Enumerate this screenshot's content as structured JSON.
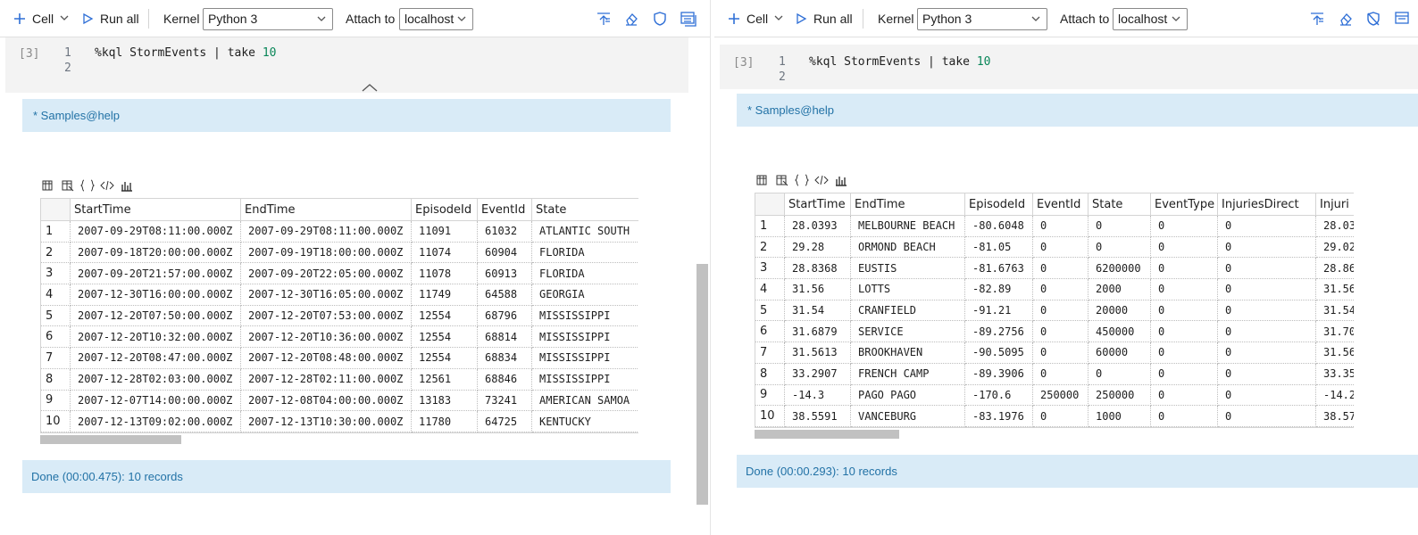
{
  "toolbar": {
    "add_cell_label": "Cell",
    "run_all_label": "Run all",
    "kernel_label": "Kernel",
    "kernel_value": "Python 3",
    "attach_label": "Attach to",
    "attach_value": "localhost"
  },
  "left": {
    "cell_number": "[3]",
    "line_numbers": [
      "1",
      "2"
    ],
    "code_text": "%kql StormEvents | take ",
    "code_number": "10",
    "info_banner": "* Samples@help",
    "done_banner": "Done (00:00.475): 10 records",
    "table": {
      "columns": [
        "",
        "StartTime",
        "EndTime",
        "EpisodeId",
        "EventId",
        "State"
      ],
      "rows": [
        [
          "1",
          "2007-09-29T08:11:00.000Z",
          "2007-09-29T08:11:00.000Z",
          "11091",
          "61032",
          "ATLANTIC SOUTH"
        ],
        [
          "2",
          "2007-09-18T20:00:00.000Z",
          "2007-09-19T18:00:00.000Z",
          "11074",
          "60904",
          "FLORIDA"
        ],
        [
          "3",
          "2007-09-20T21:57:00.000Z",
          "2007-09-20T22:05:00.000Z",
          "11078",
          "60913",
          "FLORIDA"
        ],
        [
          "4",
          "2007-12-30T16:00:00.000Z",
          "2007-12-30T16:05:00.000Z",
          "11749",
          "64588",
          "GEORGIA"
        ],
        [
          "5",
          "2007-12-20T07:50:00.000Z",
          "2007-12-20T07:53:00.000Z",
          "12554",
          "68796",
          "MISSISSIPPI"
        ],
        [
          "6",
          "2007-12-20T10:32:00.000Z",
          "2007-12-20T10:36:00.000Z",
          "12554",
          "68814",
          "MISSISSIPPI"
        ],
        [
          "7",
          "2007-12-20T08:47:00.000Z",
          "2007-12-20T08:48:00.000Z",
          "12554",
          "68834",
          "MISSISSIPPI"
        ],
        [
          "8",
          "2007-12-28T02:03:00.000Z",
          "2007-12-28T02:11:00.000Z",
          "12561",
          "68846",
          "MISSISSIPPI"
        ],
        [
          "9",
          "2007-12-07T14:00:00.000Z",
          "2007-12-08T04:00:00.000Z",
          "13183",
          "73241",
          "AMERICAN SAMOA"
        ],
        [
          "10",
          "2007-12-13T09:02:00.000Z",
          "2007-12-13T10:30:00.000Z",
          "11780",
          "64725",
          "KENTUCKY"
        ]
      ]
    }
  },
  "right": {
    "cell_number": "[3]",
    "line_numbers": [
      "1",
      "2"
    ],
    "code_text": "%kql StormEvents | take ",
    "code_number": "10",
    "info_banner": "* Samples@help",
    "done_banner": "Done (00:00.293): 10 records",
    "table": {
      "columns": [
        "",
        "StartTime",
        "EndTime",
        "EpisodeId",
        "EventId",
        "State",
        "EventType",
        "InjuriesDirect",
        "Injuri"
      ],
      "rows": [
        [
          "1",
          "28.0393",
          "MELBOURNE BEACH",
          "-80.6048",
          "0",
          "0",
          "0",
          "0",
          "28.03"
        ],
        [
          "2",
          "29.28",
          "ORMOND BEACH",
          "-81.05",
          "0",
          "0",
          "0",
          "0",
          "29.02"
        ],
        [
          "3",
          "28.8368",
          "EUSTIS",
          "-81.6763",
          "0",
          "6200000",
          "0",
          "0",
          "28.86"
        ],
        [
          "4",
          "31.56",
          "LOTTS",
          "-82.89",
          "0",
          "2000",
          "0",
          "0",
          "31.56"
        ],
        [
          "5",
          "31.54",
          "CRANFIELD",
          "-91.21",
          "0",
          "20000",
          "0",
          "0",
          "31.54"
        ],
        [
          "6",
          "31.6879",
          "SERVICE",
          "-89.2756",
          "0",
          "450000",
          "0",
          "0",
          "31.70"
        ],
        [
          "7",
          "31.5613",
          "BROOKHAVEN",
          "-90.5095",
          "0",
          "60000",
          "0",
          "0",
          "31.56"
        ],
        [
          "8",
          "33.2907",
          "FRENCH CAMP",
          "-89.3906",
          "0",
          "0",
          "0",
          "0",
          "33.35"
        ],
        [
          "9",
          "-14.3",
          "PAGO PAGO",
          "-170.6",
          "250000",
          "250000",
          "0",
          "0",
          "-14.2"
        ],
        [
          "10",
          "38.5591",
          "VANCEBURG",
          "-83.1976",
          "0",
          "1000",
          "0",
          "0",
          "38.57"
        ]
      ]
    }
  },
  "icons": {
    "add": "plus-icon",
    "run": "play-icon",
    "chevron": "chevron-down-icon",
    "collapse": "chevron-up-icon",
    "toolbar_right": [
      "collapse-cells-icon",
      "clear-outputs-icon",
      "trusted-shield-icon",
      "view-toggle-icon"
    ],
    "grid_tools": [
      "save-csv-icon",
      "save-excel-icon",
      "save-json-icon",
      "save-xml-icon",
      "chart-icon"
    ]
  },
  "colors": {
    "accent": "#2f6fd6",
    "banner_bg": "#d9ebf7",
    "banner_text": "#2272a6",
    "code_number": "#098658"
  }
}
